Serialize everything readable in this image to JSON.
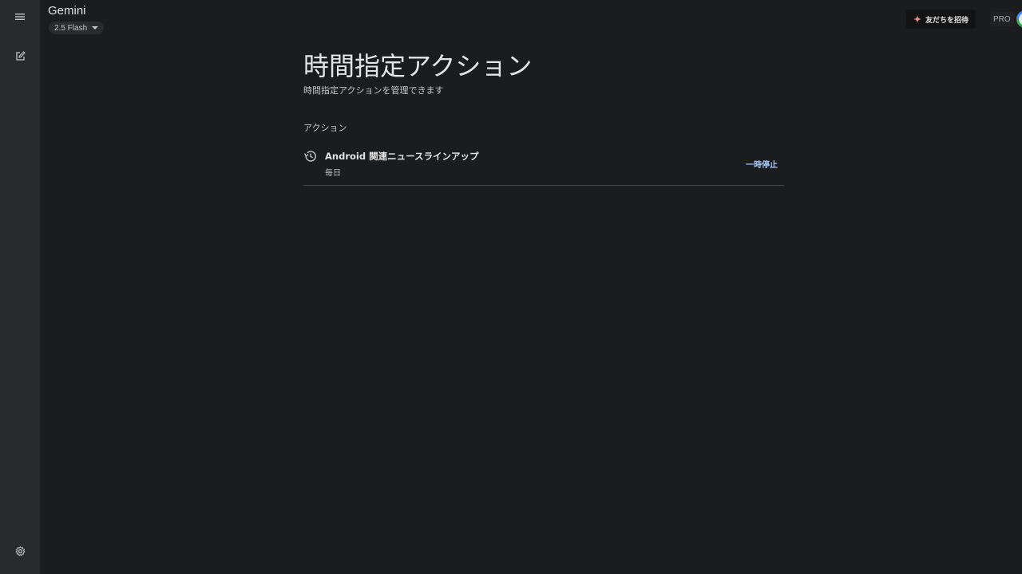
{
  "header": {
    "brand": "Gemini",
    "model": "2.5 Flash",
    "invite_label": "友だちを招待",
    "plan_badge": "PRO"
  },
  "page": {
    "title": "時間指定アクション",
    "subtitle": "時間指定アクションを管理できます",
    "section_label": "アクション"
  },
  "actions": [
    {
      "title": "Android 関連ニュースラインアップ",
      "schedule": "毎日",
      "pause_label": "一時停止",
      "icon": "history-icon"
    }
  ],
  "icons": {
    "menu": "menu-icon",
    "new_chat": "edit-icon",
    "settings": "gear-icon",
    "sparkle": "sparkle-icon"
  },
  "colors": {
    "background": "#1b1c1e",
    "rail": "#282a2c",
    "link": "#a8c7fa",
    "sparkle": "#f28b82"
  }
}
